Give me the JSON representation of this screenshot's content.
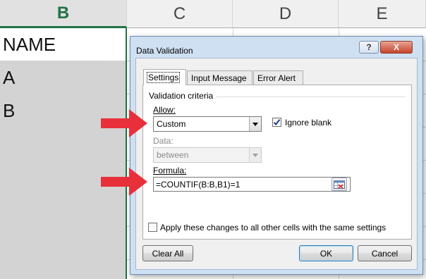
{
  "spreadsheet": {
    "columns": [
      "B",
      "C",
      "D",
      "E"
    ],
    "active_column": "B",
    "cells_b": [
      "NAME",
      "A",
      "B"
    ]
  },
  "dialog": {
    "title": "Data Validation",
    "help_glyph": "?",
    "close_glyph": "X",
    "tabs": [
      {
        "label": "Settings",
        "active": true
      },
      {
        "label": "Input Message",
        "active": false
      },
      {
        "label": "Error Alert",
        "active": false
      }
    ],
    "group_title": "Validation criteria",
    "allow": {
      "label": "Allow:",
      "value": "Custom"
    },
    "ignore_blank": {
      "label": "Ignore blank",
      "checked": true
    },
    "data": {
      "label": "Data:",
      "value": "between",
      "disabled": true
    },
    "formula": {
      "label": "Formula:",
      "value": "=COUNTIF(B:B,B1)=1"
    },
    "apply_all": {
      "label": "Apply these changes to all other cells with the same settings",
      "checked": false
    },
    "buttons": {
      "clear_all": "Clear All",
      "ok": "OK",
      "cancel": "Cancel"
    }
  },
  "colors": {
    "excel_green": "#217346",
    "arrow_red": "#e8303a",
    "dialog_frame": "#cfe0f3",
    "selection_gray": "#d3d3d3"
  }
}
